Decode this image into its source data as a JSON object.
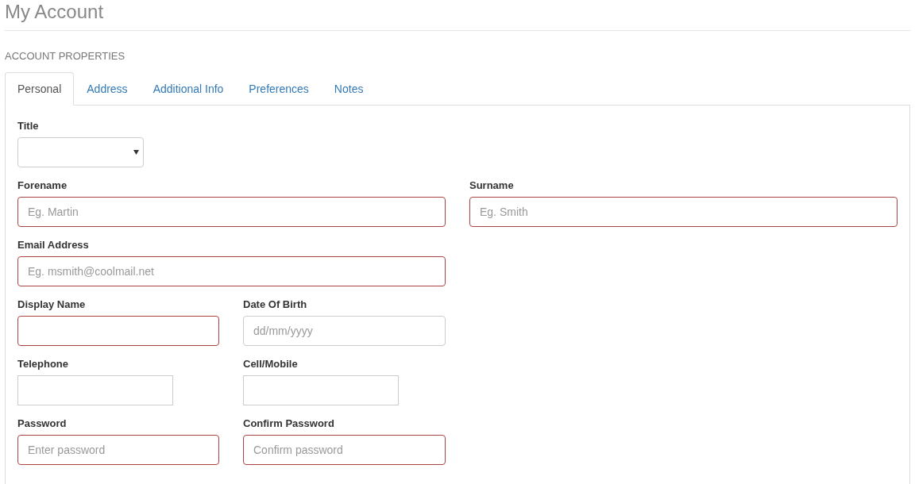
{
  "page": {
    "title": "My Account",
    "section": "ACCOUNT PROPERTIES"
  },
  "tabs": [
    {
      "label": "Personal",
      "selected": true
    },
    {
      "label": "Address",
      "selected": false
    },
    {
      "label": "Additional Info",
      "selected": false
    },
    {
      "label": "Preferences",
      "selected": false
    },
    {
      "label": "Notes",
      "selected": false
    }
  ],
  "rows": [
    {
      "kind": "wide",
      "fields": [
        {
          "kind": "select",
          "label": "Title",
          "invalid": false
        }
      ]
    },
    {
      "kind": "wide",
      "fields": [
        {
          "kind": "text",
          "label": "Forename",
          "placeholder": "Eg. Martin",
          "invalid": true
        },
        {
          "kind": "text",
          "label": "Surname",
          "placeholder": "Eg. Smith",
          "invalid": true
        }
      ]
    },
    {
      "kind": "wide",
      "fields": [
        {
          "kind": "text",
          "label": "Email Address",
          "placeholder": "Eg. msmith@coolmail.net",
          "invalid": true
        }
      ]
    },
    {
      "kind": "narrow",
      "fields": [
        {
          "kind": "text",
          "label": "Display Name",
          "invalid": true
        },
        {
          "kind": "text",
          "label": "Date Of Birth",
          "placeholder": "dd/mm/yyyy",
          "invalid": false
        }
      ]
    },
    {
      "kind": "narrow",
      "fields": [
        {
          "kind": "short",
          "label": "Telephone",
          "invalid": false
        },
        {
          "kind": "short",
          "label": "Cell/Mobile",
          "invalid": false
        }
      ]
    },
    {
      "kind": "narrow",
      "fields": [
        {
          "kind": "text",
          "label": "Password",
          "placeholder": "Enter password",
          "invalid": true
        },
        {
          "kind": "text",
          "label": "Confirm Password",
          "placeholder": "Confirm password",
          "invalid": true
        }
      ]
    }
  ]
}
